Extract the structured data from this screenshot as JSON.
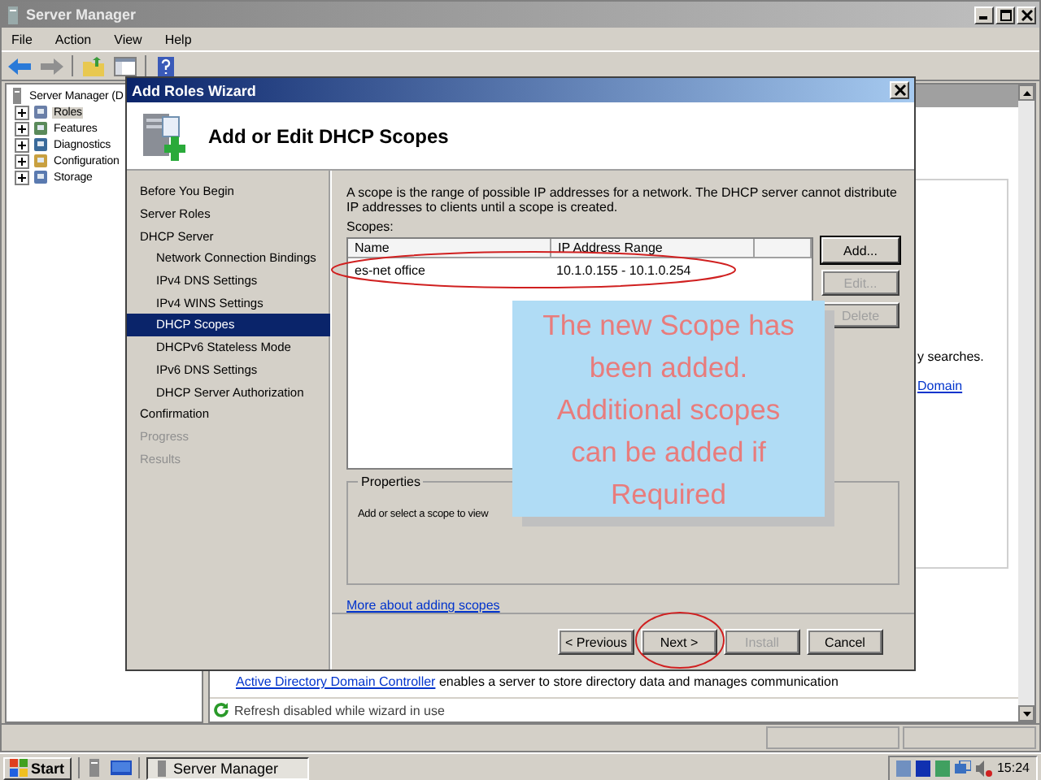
{
  "window": {
    "title": "Server Manager"
  },
  "menu": [
    "File",
    "Action",
    "View",
    "Help"
  ],
  "tree": {
    "root": "Server Manager (D",
    "children": [
      {
        "label": "Roles",
        "selected": true,
        "expanded": false
      },
      {
        "label": "Features",
        "selected": false,
        "expanded": false
      },
      {
        "label": "Diagnostics",
        "selected": false,
        "expanded": false
      },
      {
        "label": "Configuration",
        "selected": false,
        "expanded": false
      },
      {
        "label": "Storage",
        "selected": false,
        "expanded": false
      }
    ]
  },
  "right_pane": {
    "fragment": "y searches.",
    "link": "Domain",
    "description": {
      "link": "Active Directory Domain Controller",
      "text": "enables a server to store directory data and manages communication"
    },
    "status": "Refresh disabled while wizard in use"
  },
  "wizard": {
    "title": "Add Roles Wizard",
    "heading": "Add or Edit DHCP Scopes",
    "steps": [
      {
        "label": "Before You Begin",
        "selected": false,
        "disabled": false
      },
      {
        "label": "Server Roles",
        "selected": false,
        "disabled": false
      },
      {
        "label": "DHCP Server",
        "selected": false,
        "disabled": false,
        "children": [
          {
            "label": "Network Connection Bindings",
            "selected": false,
            "disabled": false
          },
          {
            "label": "IPv4 DNS Settings",
            "selected": false,
            "disabled": false
          },
          {
            "label": "IPv4 WINS Settings",
            "selected": false,
            "disabled": false
          },
          {
            "label": "DHCP Scopes",
            "selected": true,
            "disabled": false
          },
          {
            "label": "DHCPv6 Stateless Mode",
            "selected": false,
            "disabled": false
          },
          {
            "label": "IPv6 DNS Settings",
            "selected": false,
            "disabled": false
          },
          {
            "label": "DHCP Server Authorization",
            "selected": false,
            "disabled": false
          }
        ]
      },
      {
        "label": "Confirmation",
        "selected": false,
        "disabled": false
      },
      {
        "label": "Progress",
        "selected": false,
        "disabled": true
      },
      {
        "label": "Results",
        "selected": false,
        "disabled": true
      }
    ],
    "intro": "A scope is the range of possible IP addresses for a network. The DHCP server cannot distribute IP addresses to clients until a scope is created.",
    "scopes_label": "Scopes:",
    "columns": [
      "Name",
      "IP Address Range"
    ],
    "rows": [
      {
        "name": "es-net office",
        "range": "10.1.0.155 - 10.1.0.254"
      }
    ],
    "side_buttons": [
      {
        "label": "Add...",
        "disabled": false
      },
      {
        "label": "Edit...",
        "disabled": true
      },
      {
        "label": "Delete",
        "disabled": true
      }
    ],
    "properties": {
      "title": "Properties",
      "text": "Add or select a scope to view"
    },
    "link": "More about adding scopes",
    "buttons": [
      {
        "label": "< Previous",
        "disabled": false
      },
      {
        "label": "Next >",
        "disabled": false
      },
      {
        "label": "Install",
        "disabled": true
      },
      {
        "label": "Cancel",
        "disabled": false
      }
    ]
  },
  "callout": {
    "text": "The new Scope has been added. Additional scopes can be added if Required"
  },
  "taskbar": {
    "start": "Start",
    "tasks": [
      {
        "label": "Server Manager",
        "selected": true
      }
    ],
    "clock": "15:24"
  }
}
